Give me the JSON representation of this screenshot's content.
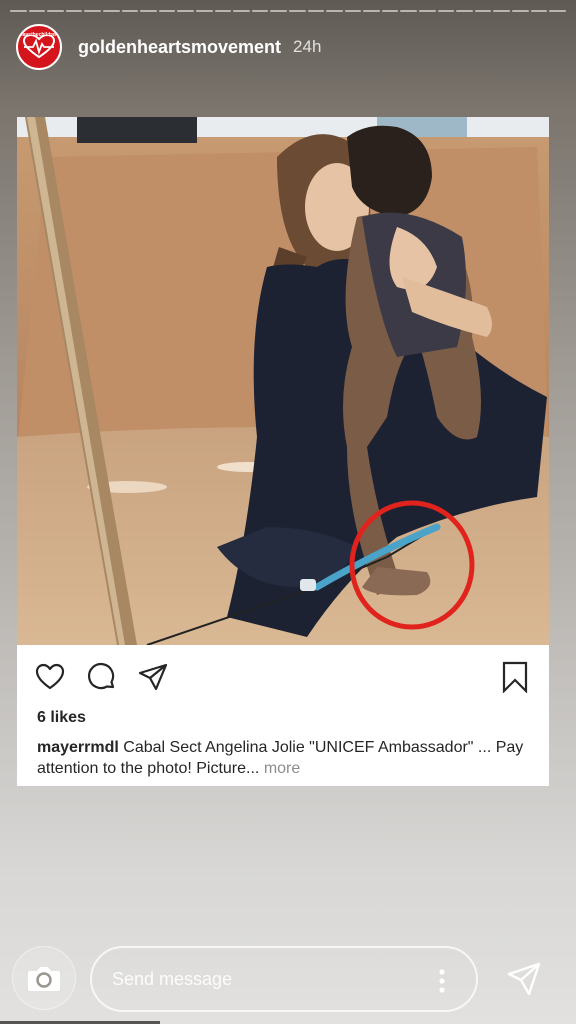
{
  "story": {
    "progress_segments": 30,
    "account": {
      "avatar_text": "savethechildren",
      "username": "goldenheartsmovement",
      "time": "24h"
    }
  },
  "post": {
    "likes": "6 likes",
    "caption_user": "mayerrmdl",
    "caption_text": "Cabal Sect Angelina Jolie \"UNICEF Ambassador\" ... Pay attention to the photo! Picture...",
    "more_label": "more",
    "icons": [
      "heart-icon",
      "comment-icon",
      "share-icon",
      "bookmark-icon"
    ]
  },
  "reply": {
    "placeholder": "Send message",
    "icons": [
      "camera-icon",
      "more-options-icon",
      "send-icon"
    ]
  },
  "colors": {
    "avatar_red": "#d4161c",
    "annotation_red": "#e0231c",
    "rope_blue": "#4aa3c8"
  }
}
